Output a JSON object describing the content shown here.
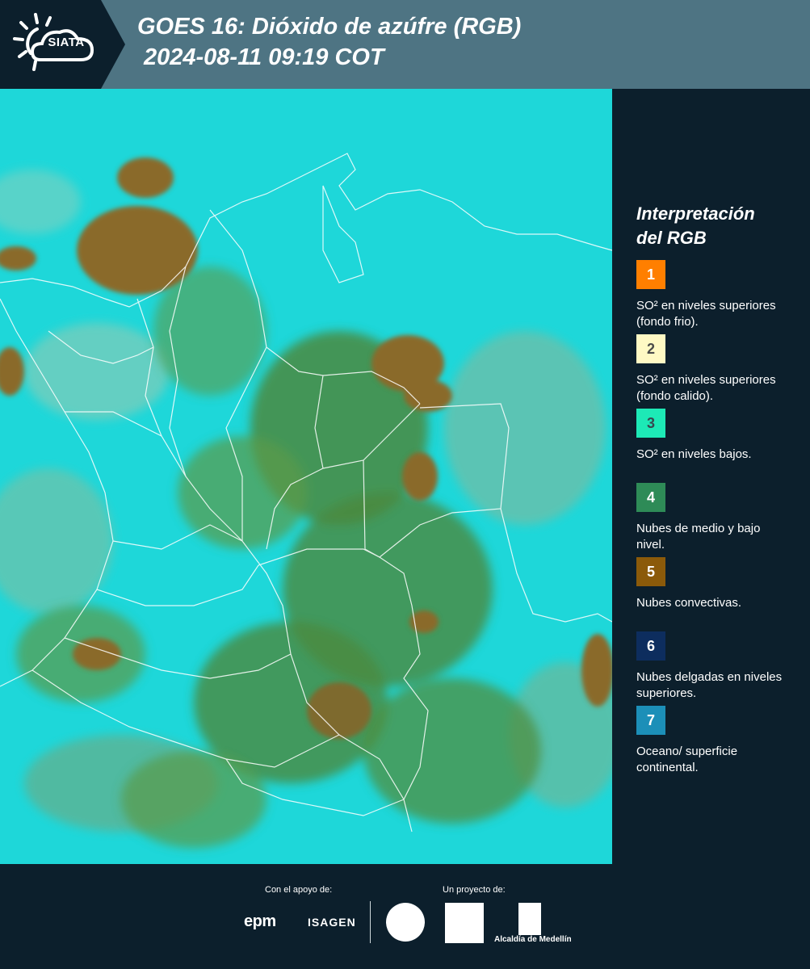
{
  "header": {
    "logo_text": "SIATA",
    "title_line1": "GOES 16: Dióxido de azúfre (RGB)",
    "title_line2": "2024-08-11 09:19 COT"
  },
  "map": {
    "icon": "satellite-rgb-map",
    "base_color": "#1ed7d9",
    "cloud_colors": [
      "#8a6a2c",
      "#4b8a3e",
      "#6fb8a0"
    ]
  },
  "legend": {
    "title_line1": "Interpretación",
    "title_line2": "del RGB",
    "items": [
      {
        "number": "1",
        "color": "#ff7f00",
        "text_color": "#ffffff",
        "label": "SO² en niveles superiores (fondo frio)."
      },
      {
        "number": "2",
        "color": "#fff9c4",
        "text_color": "#4a4a4a",
        "label": "SO² en niveles superiores (fondo calido)."
      },
      {
        "number": "3",
        "color": "#1de9b6",
        "text_color": "#37474f",
        "label": "SO² en niveles bajos."
      },
      {
        "number": "4",
        "color": "#2e8b57",
        "text_color": "#ffffff",
        "label": "Nubes de medio y bajo nivel."
      },
      {
        "number": "5",
        "color": "#8b5a0a",
        "text_color": "#ffffff",
        "label": "Nubes convectivas."
      },
      {
        "number": "6",
        "color": "#0d2d5e",
        "text_color": "#ffffff",
        "label": "Nubes delgadas en niveles superiores."
      },
      {
        "number": "7",
        "color": "#1c8fb8",
        "text_color": "#ffffff",
        "label": "Oceano/ superficie continental."
      }
    ]
  },
  "footer": {
    "support_label": "Con el apoyo de:",
    "project_label": "Un proyecto de:",
    "epm": "epm",
    "isagen": "ISAGEN",
    "alcaldia": "Alcaldía de Medellín"
  }
}
